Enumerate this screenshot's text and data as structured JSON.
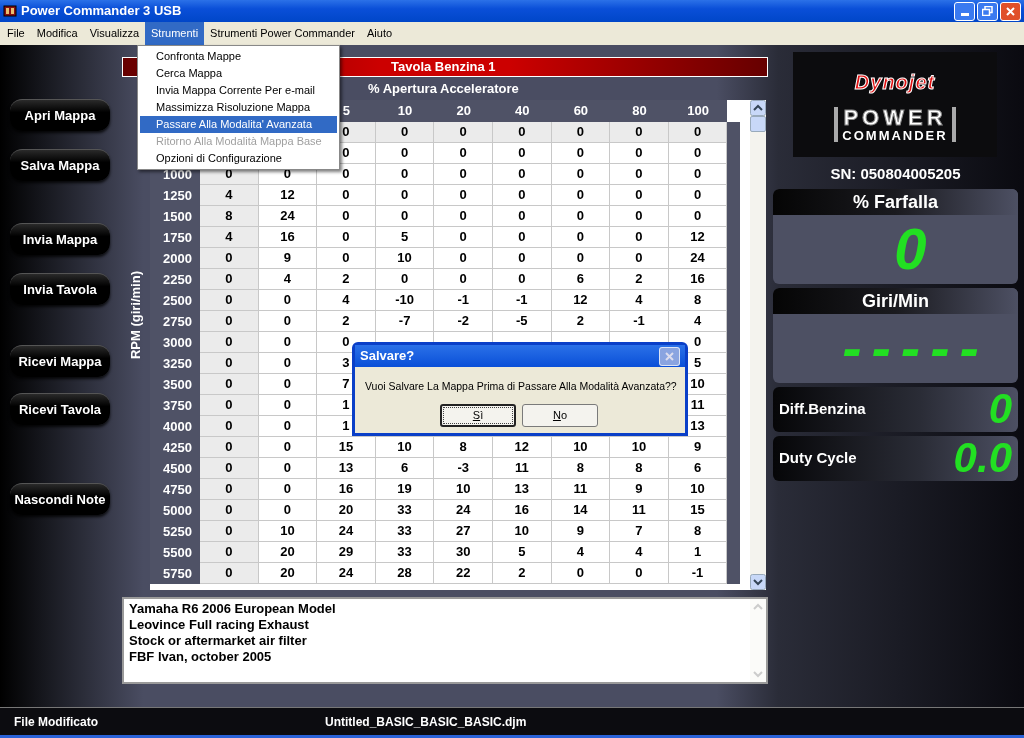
{
  "window": {
    "title": "Power Commander 3 USB"
  },
  "menu_bar": [
    {
      "label": "File",
      "selected": false
    },
    {
      "label": "Modifica",
      "selected": false
    },
    {
      "label": "Visualizza",
      "selected": false
    },
    {
      "label": "Strumenti",
      "selected": true
    },
    {
      "label": "Strumenti Power Commander",
      "selected": false
    },
    {
      "label": "Aiuto",
      "selected": false
    }
  ],
  "menu": {
    "items": [
      {
        "label": "Confronta Mappe",
        "selected": false,
        "disabled": false
      },
      {
        "label": "Cerca Mappa",
        "selected": false,
        "disabled": false
      },
      {
        "label": "Invia Mappa Corrente Per e-mail",
        "selected": false,
        "disabled": false
      },
      {
        "label": "Massimizza Risoluzione Mappa",
        "selected": false,
        "disabled": false
      },
      {
        "label": "Passare Alla Modalita' Avanzata",
        "selected": true,
        "disabled": false
      },
      {
        "label": "Ritorno Alla Modalità Mappa Base",
        "selected": false,
        "disabled": true
      },
      {
        "label": "Opzioni di Configurazione",
        "selected": false,
        "disabled": false
      }
    ]
  },
  "side_buttons": [
    "Apri Mappa",
    "Salva Mappa",
    "Invia Mappa",
    "Invia Tavola",
    "Ricevi Mappa",
    "Ricevi Tavola",
    "Nascondi Note"
  ],
  "table": {
    "title": "Tavola Benzina 1",
    "column_header": "% Apertura Acceleratore",
    "row_header": "RPM (giri/min)",
    "columns": [
      null,
      null,
      "5",
      "10",
      "20",
      "40",
      "60",
      "80",
      "100"
    ],
    "rows": [
      {
        "rpm": null,
        "cells": [
          null,
          null,
          "0",
          "0",
          "0",
          "0",
          "0",
          "0",
          "0"
        ]
      },
      {
        "rpm": null,
        "cells": [
          null,
          null,
          "0",
          "0",
          "0",
          "0",
          "0",
          "0",
          "0"
        ]
      },
      {
        "rpm": "1000",
        "cells": [
          "0",
          "0",
          "0",
          "0",
          "0",
          "0",
          "0",
          "0",
          "0"
        ]
      },
      {
        "rpm": "1250",
        "cells": [
          "4",
          "12",
          "0",
          "0",
          "0",
          "0",
          "0",
          "0",
          "0"
        ]
      },
      {
        "rpm": "1500",
        "cells": [
          "8",
          "24",
          "0",
          "0",
          "0",
          "0",
          "0",
          "0",
          "0"
        ]
      },
      {
        "rpm": "1750",
        "cells": [
          "4",
          "16",
          "0",
          "5",
          "0",
          "0",
          "0",
          "0",
          "12"
        ]
      },
      {
        "rpm": "2000",
        "cells": [
          "0",
          "9",
          "0",
          "10",
          "0",
          "0",
          "0",
          "0",
          "24"
        ]
      },
      {
        "rpm": "2250",
        "cells": [
          "0",
          "4",
          "2",
          "0",
          "0",
          "0",
          "6",
          "2",
          "16"
        ]
      },
      {
        "rpm": "2500",
        "cells": [
          "0",
          "0",
          "4",
          "-10",
          "-1",
          "-1",
          "12",
          "4",
          "8"
        ]
      },
      {
        "rpm": "2750",
        "cells": [
          "0",
          "0",
          "2",
          "-7",
          "-2",
          "-5",
          "2",
          "-1",
          "4"
        ]
      },
      {
        "rpm": "3000",
        "cells": [
          "0",
          "0",
          "0",
          null,
          null,
          null,
          null,
          null,
          "0"
        ]
      },
      {
        "rpm": "3250",
        "cells": [
          "0",
          "0",
          "3",
          null,
          null,
          null,
          null,
          null,
          "5"
        ]
      },
      {
        "rpm": "3500",
        "cells": [
          "0",
          "0",
          "7",
          null,
          null,
          null,
          null,
          null,
          "10"
        ]
      },
      {
        "rpm": "3750",
        "cells": [
          "0",
          "0",
          "1",
          null,
          null,
          null,
          null,
          null,
          "11"
        ]
      },
      {
        "rpm": "4000",
        "cells": [
          "0",
          "0",
          "1",
          null,
          null,
          null,
          null,
          null,
          "13"
        ]
      },
      {
        "rpm": "4250",
        "cells": [
          "0",
          "0",
          "15",
          "10",
          "8",
          "12",
          "10",
          "10",
          "9"
        ]
      },
      {
        "rpm": "4500",
        "cells": [
          "0",
          "0",
          "13",
          "6",
          "-3",
          "11",
          "8",
          "8",
          "6"
        ]
      },
      {
        "rpm": "4750",
        "cells": [
          "0",
          "0",
          "16",
          "19",
          "10",
          "13",
          "11",
          "9",
          "10"
        ]
      },
      {
        "rpm": "5000",
        "cells": [
          "0",
          "0",
          "20",
          "33",
          "24",
          "16",
          "14",
          "11",
          "15"
        ]
      },
      {
        "rpm": "5250",
        "cells": [
          "0",
          "10",
          "24",
          "33",
          "27",
          "10",
          "9",
          "7",
          "8"
        ]
      },
      {
        "rpm": "5500",
        "cells": [
          "0",
          "20",
          "29",
          "33",
          "30",
          "5",
          "4",
          "4",
          "1"
        ]
      },
      {
        "rpm": "5750",
        "cells": [
          "0",
          "20",
          "24",
          "28",
          "22",
          "2",
          "0",
          "0",
          "-1"
        ]
      }
    ]
  },
  "notes": [
    "Yamaha R6 2006 European Model",
    "Leovince Full racing Exhaust",
    "Stock or aftermarket air filter",
    "FBF Ivan, october 2005"
  ],
  "logo": {
    "brand": "Dynojet",
    "product_top": "POWER",
    "product_bottom": "COMMANDER"
  },
  "serial": "SN: 050804005205",
  "gauges": [
    {
      "kind": "large",
      "label": "% Farfalla",
      "value": "0"
    },
    {
      "kind": "large",
      "label": "Giri/Min",
      "value": "-----"
    },
    {
      "kind": "small",
      "label": "Diff.Benzina",
      "value": "0"
    },
    {
      "kind": "small",
      "label": "Duty Cycle",
      "value": "0.0"
    }
  ],
  "status_bar": {
    "state": "File Modificato",
    "file": "Untitled_BASIC_BASIC_BASIC.djm"
  },
  "dialog": {
    "title": "Salvare?",
    "message": "Vuoi Salvare La Mappa Prima di Passare Alla Modalità Avanzata??",
    "buttons": [
      {
        "label": "Sì",
        "focused": true
      },
      {
        "label": "No",
        "focused": false
      }
    ]
  }
}
